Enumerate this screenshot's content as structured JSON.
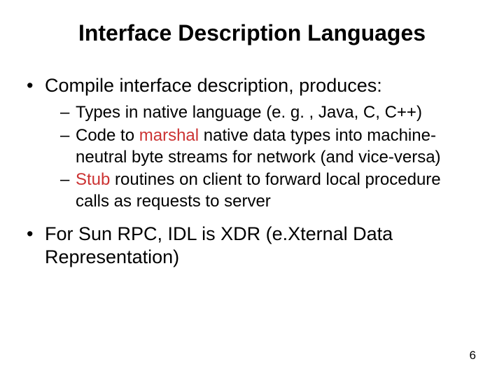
{
  "title": "Interface Description Languages",
  "bullets": [
    {
      "text": "Compile interface description, produces:",
      "sub": [
        {
          "segments": [
            {
              "t": "Types in native language (e. g. , Java, C, C++)",
              "emph": false
            }
          ]
        },
        {
          "segments": [
            {
              "t": "Code to ",
              "emph": false
            },
            {
              "t": "marshal",
              "emph": true
            },
            {
              "t": " native data types into machine-neutral byte streams for network (and vice-versa)",
              "emph": false
            }
          ]
        },
        {
          "segments": [
            {
              "t": "Stub",
              "emph": true
            },
            {
              "t": " routines on client to forward local procedure calls as requests to server",
              "emph": false
            }
          ]
        }
      ]
    },
    {
      "text": "For Sun RPC, IDL is XDR (e.Xternal Data Representation)",
      "sub": []
    }
  ],
  "page_number": "6"
}
